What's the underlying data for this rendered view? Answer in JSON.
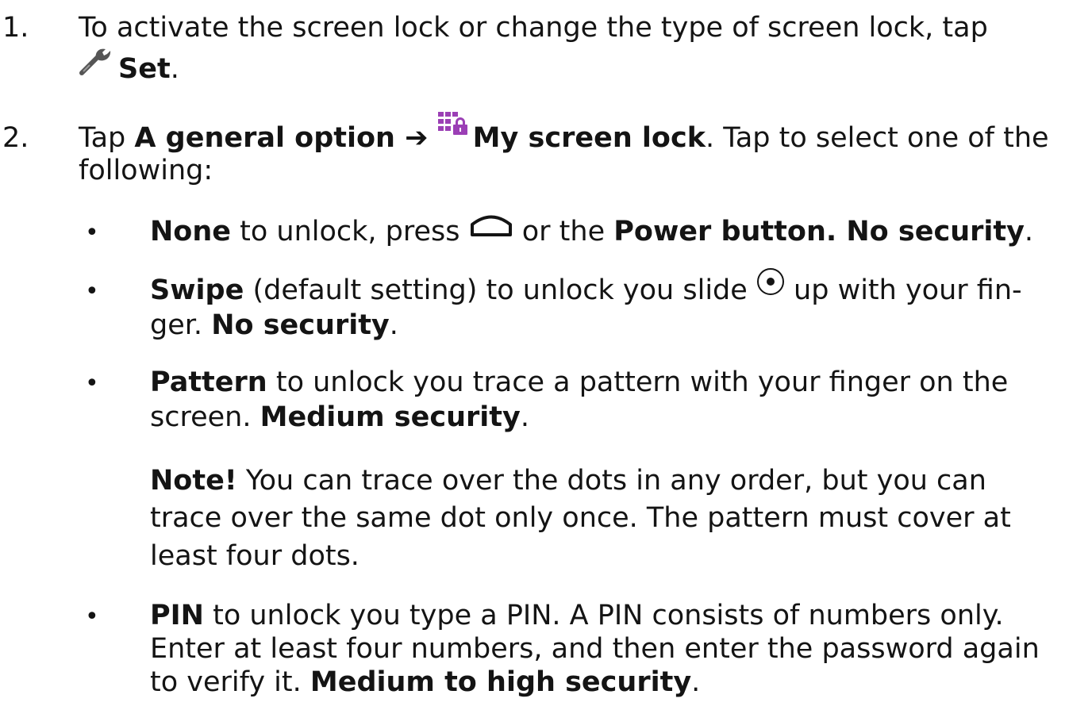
{
  "steps": [
    {
      "number": "1.",
      "line1": "To activate the screen lock or change the type of screen lock, tap",
      "set_label": "Set",
      "set_end": ".",
      "set_icon": "wrench-icon"
    },
    {
      "number": "2.",
      "tap": "Tap ",
      "general_option": "A general option",
      "arrow": " ➔ ",
      "my_screen_lock": "My screen lock",
      "my_screen_lock_icon": "screen-lock-icon",
      "rest": ". Tap to select one of the",
      "line2": "following:"
    }
  ],
  "options": {
    "bullet": "•",
    "none": {
      "label": "None",
      "text_a": " to unlock, press ",
      "home_icon": "home-icon",
      "text_b": " or the ",
      "power": "Power button",
      "text_c": ". ",
      "security": "No security",
      "end": "."
    },
    "swipe": {
      "label": "Swipe",
      "text_a": " (default setting) to unlock you slide ",
      "slide_icon": "slide-circle-icon",
      "text_b": " up with your fin-",
      "line2_a": "ger. ",
      "security": "No security",
      "end": "."
    },
    "pattern": {
      "label": "Pattern",
      "text_a": " to unlock you trace a pattern with your finger on the",
      "line2_a": "screen. ",
      "security": "Medium security",
      "end": "."
    },
    "note": {
      "label": "Note!",
      "line1": " You can trace over the dots in any order, but you can",
      "line2": "trace over the same dot only once. The pattern must cover at",
      "line3": "least four dots."
    },
    "pin": {
      "label": "PIN",
      "text_a": " to unlock you type a PIN. A PIN consists of numbers only.",
      "line2": "Enter at least four numbers, and then enter the password again",
      "line3_a": "to verify it. ",
      "security": "Medium to high security",
      "end": "."
    }
  },
  "colors": {
    "text": "#141414",
    "icon_purple": "#9b3fb5",
    "icon_gray": "#555555"
  }
}
